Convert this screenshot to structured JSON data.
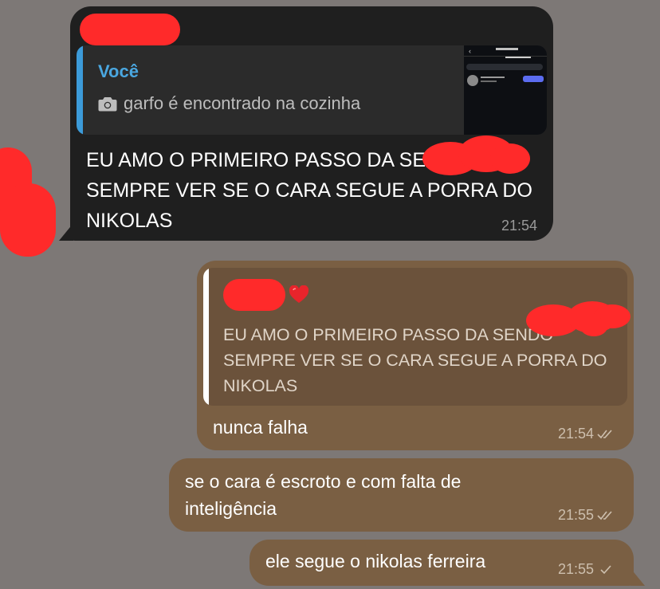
{
  "colors": {
    "background": "#7d7876",
    "incoming_bubble": "#1f1f1f",
    "outgoing_bubble": "#7a5f43",
    "reply_accent": "#3c9bd9",
    "redaction": "#ff2a2a"
  },
  "messages": [
    {
      "direction": "incoming",
      "reply": {
        "author": "Você",
        "media_icon": "camera-icon",
        "media_caption": "garfo é encontrado na cozinha"
      },
      "text": "EU AMO O PRIMEIRO PASSO DA           SENDO SEMPRE VER SE O CARA SEGUE A PORRA DO NIKOLAS",
      "time": "21:54"
    },
    {
      "direction": "outgoing",
      "reply": {
        "author_emoji": "heart-icon",
        "text": "EU AMO O PRIMEIRO PASSO DA           SENDO SEMPRE VER SE O CARA SEGUE A PORRA DO NIKOLAS"
      },
      "text": "nunca falha",
      "time": "21:54",
      "status": "read-double-check"
    },
    {
      "direction": "outgoing",
      "text": "se o cara é escroto e com falta de inteligência",
      "time": "21:55",
      "status": "read-double-check"
    },
    {
      "direction": "outgoing",
      "text": "ele segue o nikolas ferreira",
      "time": "21:55",
      "status": "sent-single-check"
    }
  ]
}
